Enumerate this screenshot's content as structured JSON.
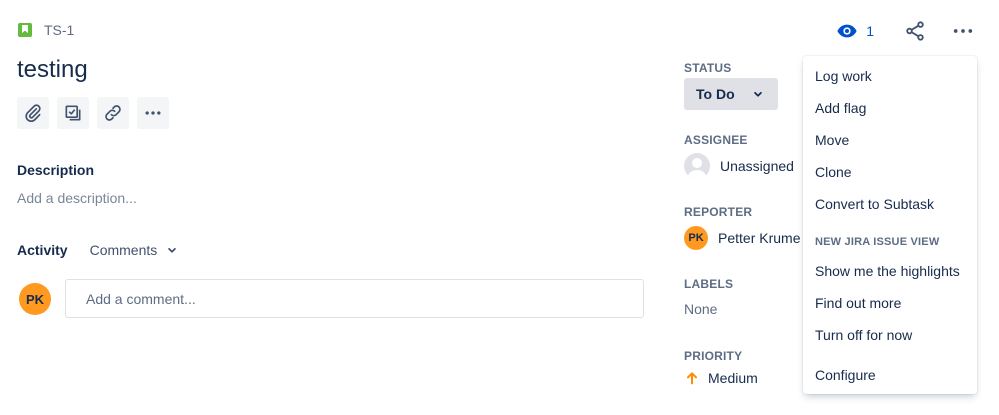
{
  "issue": {
    "key": "TS-1",
    "title": "testing",
    "issue_type_icon": "story-icon"
  },
  "toolbar": {
    "attach_icon": "paperclip-icon",
    "subtask_icon": "subtask-icon",
    "link_icon": "link-icon",
    "more_icon": "more-icon"
  },
  "description": {
    "heading": "Description",
    "placeholder": "Add a description..."
  },
  "activity": {
    "label": "Activity",
    "filter": "Comments",
    "comment_placeholder": "Add a comment...",
    "user_initials": "PK"
  },
  "header_actions": {
    "watch_count": "1"
  },
  "fields": {
    "status_label": "STATUS",
    "status_value": "To Do",
    "assignee_label": "ASSIGNEE",
    "assignee_value": "Unassigned",
    "reporter_label": "REPORTER",
    "reporter_value": "Petter Krume",
    "reporter_initials": "PK",
    "labels_label": "LABELS",
    "labels_value": "None",
    "priority_label": "PRIORITY",
    "priority_value": "Medium"
  },
  "menu": {
    "items": [
      "Log work",
      "Add flag",
      "Move",
      "Clone",
      "Convert to Subtask"
    ],
    "section_heading": "NEW JIRA ISSUE VIEW",
    "section_items": [
      "Show me the highlights",
      "Find out more",
      "Turn off for now"
    ],
    "footer_item": "Configure"
  },
  "colors": {
    "avatar": "#ff991f",
    "watch": "#0052cc",
    "story": "#63ba3c",
    "priority_medium": "#ff8b00"
  }
}
